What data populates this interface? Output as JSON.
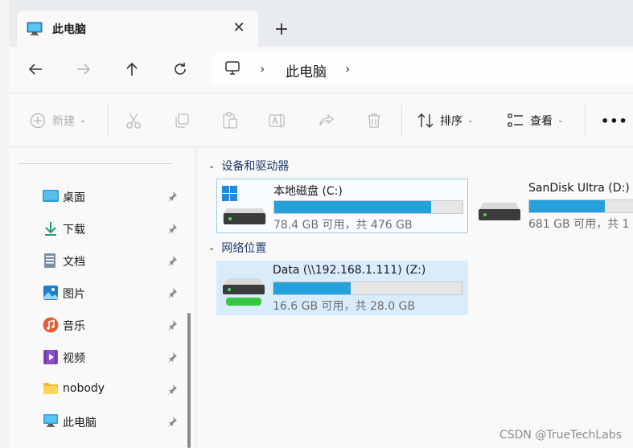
{
  "window": {
    "tab_title": "此电脑"
  },
  "navigation": {
    "breadcrumb": [
      "此电脑"
    ]
  },
  "command_bar": {
    "new_label": "新建",
    "sort_label": "排序",
    "view_label": "查看",
    "more_label": "•••"
  },
  "sidebar": {
    "items": [
      {
        "label": "桌面",
        "icon": "desktop-folder-icon"
      },
      {
        "label": "下载",
        "icon": "download-arrow-icon"
      },
      {
        "label": "文档",
        "icon": "document-icon"
      },
      {
        "label": "图片",
        "icon": "pictures-icon"
      },
      {
        "label": "音乐",
        "icon": "music-icon"
      },
      {
        "label": "视频",
        "icon": "video-icon"
      },
      {
        "label": "nobody",
        "icon": "yellow-folder-icon"
      },
      {
        "label": "此电脑",
        "icon": "this-pc-icon"
      }
    ]
  },
  "groups": {
    "devices": {
      "header": "设备和驱动器",
      "drives": [
        {
          "name": "本地磁盘 (C:)",
          "info": "78.4 GB 可用，共 476 GB",
          "used_fraction": 0.835
        },
        {
          "name": "SanDisk Ultra (D:)",
          "info": "681 GB 可用，共 1",
          "used_fraction": 0.4
        }
      ]
    },
    "network": {
      "header": "网络位置",
      "drives": [
        {
          "name": "Data (\\\\192.168.1.111) (Z:)",
          "info": "16.6 GB 可用，共 28.0 GB",
          "used_fraction": 0.41
        }
      ]
    }
  },
  "watermark": "CSDN @TrueTechLabs",
  "colors": {
    "accent": "#26a0da",
    "selection": "#d9ecfb"
  }
}
